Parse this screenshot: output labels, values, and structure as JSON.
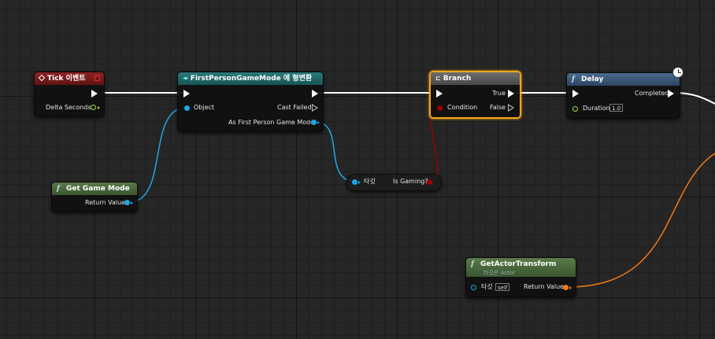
{
  "colors": {
    "event_header": "#7a1c1c",
    "cast_header": "#1f6a6a",
    "branch_header": "#5a5a5a",
    "function_header": "#3d5a78",
    "pure_header": "#4d6a3d",
    "object_pin": "#1fa6e6",
    "bool_pin": "#9a0000",
    "float_pin": "#9ade3a",
    "struct_pin": "#f07b17",
    "selection": "#f2a71b"
  },
  "nodes": {
    "tick": {
      "title": "Tick 이벤트",
      "icon": "event-diamond-icon",
      "pin_delta": "Delta Seconds"
    },
    "cast": {
      "title": "FirstPersonGameMode 에 형변환",
      "icon": "cast-arrows-icon",
      "pin_object": "Object",
      "pin_cast_failed": "Cast Failed",
      "pin_as": "As First Person Game Mode"
    },
    "branch": {
      "title": "Branch",
      "icon": "branch-icon",
      "pin_condition": "Condition",
      "pin_true": "True",
      "pin_false": "False"
    },
    "delay": {
      "title": "Delay",
      "icon": "function-icon",
      "pin_duration": "Duration",
      "duration_value": "1.0",
      "pin_completed": "Completed",
      "latent_icon": "clock-icon"
    },
    "get_game_mode": {
      "title": "Get Game Mode",
      "icon": "function-icon",
      "pin_return": "Return Value"
    },
    "is_gaming": {
      "pin_target": "타깃",
      "pin_output": "Is Gaming?"
    },
    "get_actor_transform": {
      "title": "GetActorTransform",
      "subtitle": "타깃은 Actor",
      "icon": "function-icon",
      "pin_target": "타깃",
      "target_value": "self",
      "pin_return": "Return Value"
    }
  }
}
